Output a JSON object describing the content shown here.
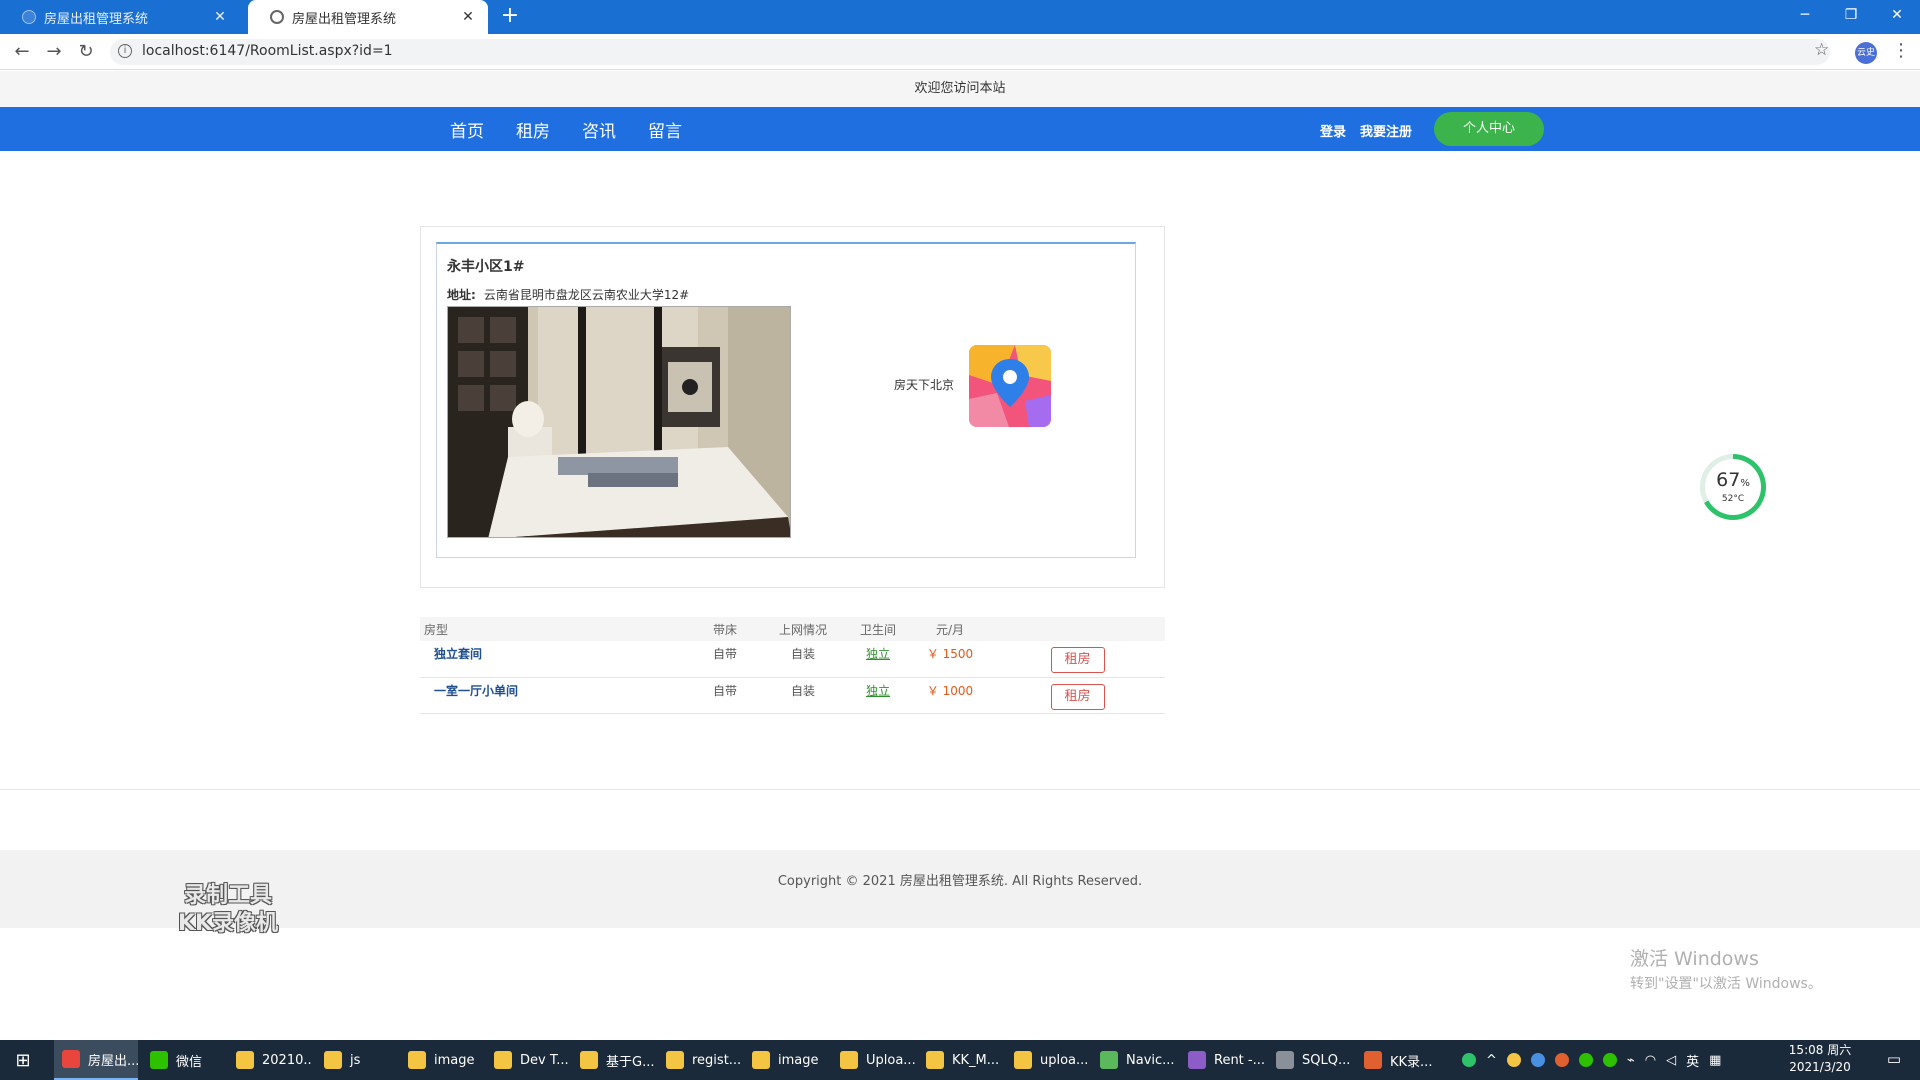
{
  "browser": {
    "tabs": [
      {
        "title": "房屋出租管理系统",
        "active": false
      },
      {
        "title": "房屋出租管理系统",
        "active": true
      }
    ],
    "new_tab": "+",
    "close_glyph": "✕",
    "url": "localhost:6147/RoomList.aspx?id=1",
    "avatar": "云史",
    "window_controls": {
      "minimize": "─",
      "restore": "❐",
      "close": "✕"
    }
  },
  "site": {
    "welcome": "欢迎您访问本站",
    "nav": [
      "首页",
      "租房",
      "咨讯",
      "留言"
    ],
    "login": "登录",
    "register": "我要注册",
    "personal_center": "个人中心",
    "nav_color": "#1f6fe0"
  },
  "detail": {
    "title": "永丰小区1#",
    "address_label": "地址:",
    "address": "云南省昆明市盘龙区云南农业大学12#",
    "map_label": "房天下北京",
    "photo_icon": "bedroom-photo",
    "map_icon": "map-pin-icon"
  },
  "rooms": {
    "headers": [
      "房型",
      "带床",
      "上网情况",
      "卫生间",
      "元/月",
      ""
    ],
    "rows": [
      {
        "type": "独立套间",
        "bed": "自带",
        "internet": "自装",
        "bathroom": "独立",
        "price": "￥ 1500",
        "action": "租房"
      },
      {
        "type": "一室一厅小单间",
        "bed": "自带",
        "internet": "自装",
        "bathroom": "独立",
        "price": "￥ 1000",
        "action": "租房"
      }
    ]
  },
  "footer": {
    "copyright": "Copyright © 2021 房屋出租管理系统. All Rights Reserved."
  },
  "overlays": {
    "watermark_line1": "录制工具",
    "watermark_line2": "KK录像机",
    "gauge_value": "67",
    "gauge_percent": 0.67,
    "gauge_unit": "%",
    "gauge_temp": "52°C",
    "activate_title": "激活 Windows",
    "activate_sub": "转到\"设置\"以激活 Windows。"
  },
  "taskbar": {
    "items": [
      {
        "label": "房屋出...",
        "icon": "chrome-icon",
        "color": "#e8453c"
      },
      {
        "label": "微信",
        "icon": "wechat-icon",
        "color": "#2dc100"
      },
      {
        "label": "20210...",
        "icon": "folder-icon",
        "color": "#f4c542"
      },
      {
        "label": "js",
        "icon": "folder-icon",
        "color": "#f4c542"
      },
      {
        "label": "image",
        "icon": "folder-icon",
        "color": "#f4c542"
      },
      {
        "label": "Dev T...",
        "icon": "folder-icon",
        "color": "#f4c542"
      },
      {
        "label": "基于G...",
        "icon": "folder-icon",
        "color": "#f4c542"
      },
      {
        "label": "regist...",
        "icon": "folder-icon",
        "color": "#f4c542"
      },
      {
        "label": "image",
        "icon": "folder-icon",
        "color": "#f4c542"
      },
      {
        "label": "Uploa...",
        "icon": "folder-icon",
        "color": "#f4c542"
      },
      {
        "label": "KK_M...",
        "icon": "folder-icon",
        "color": "#f4c542"
      },
      {
        "label": "uploa...",
        "icon": "folder-icon",
        "color": "#f4c542"
      },
      {
        "label": "Navic...",
        "icon": "navicat-icon",
        "color": "#5cb85c"
      },
      {
        "label": "Rent -...",
        "icon": "visual-studio-icon",
        "color": "#8c5cc7"
      },
      {
        "label": "SQLQ...",
        "icon": "sql-icon",
        "color": "#8a9099"
      },
      {
        "label": "KK录...",
        "icon": "kk-recorder-icon",
        "color": "#e0612f"
      }
    ],
    "ime": "英",
    "time": "15:08 周六",
    "date": "2021/3/20"
  }
}
